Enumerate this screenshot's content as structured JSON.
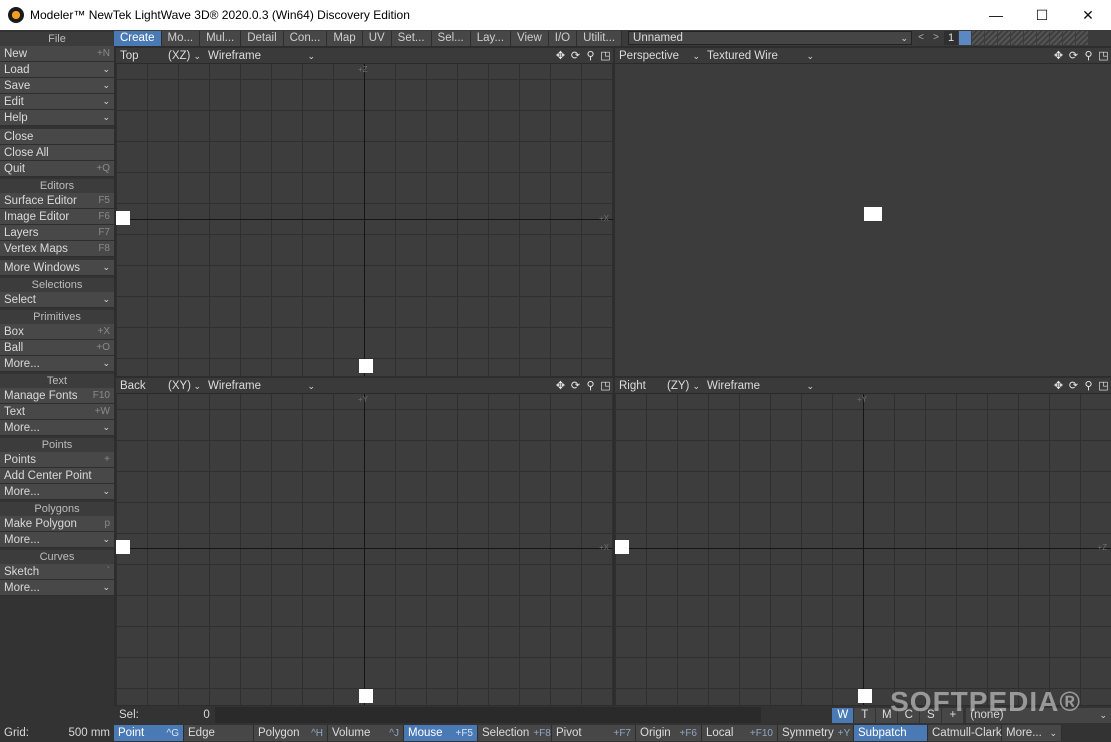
{
  "window": {
    "title": "Modeler™ NewTek LightWave 3D® 2020.0.3 (Win64) Discovery Edition",
    "minimize": "—",
    "maximize": "☐",
    "close": "✕"
  },
  "left": {
    "groups": [
      {
        "head": "File",
        "items": [
          {
            "label": "New",
            "sc": "+N"
          },
          {
            "label": "Load",
            "chev": "⌄"
          },
          {
            "label": "Save",
            "chev": "⌄"
          },
          {
            "label": "Edit",
            "chev": "⌄"
          },
          {
            "label": "Help",
            "chev": "⌄"
          }
        ]
      },
      {
        "head": "",
        "items": [
          {
            "label": "Close",
            "sc": ""
          },
          {
            "label": "Close All",
            "sc": ""
          },
          {
            "label": "Quit",
            "sc": "+Q"
          }
        ]
      },
      {
        "head": "Editors",
        "items": [
          {
            "label": "Surface Editor",
            "sc": "F5"
          },
          {
            "label": "Image Editor",
            "sc": "F6"
          },
          {
            "label": "Layers",
            "sc": "F7"
          },
          {
            "label": "Vertex Maps",
            "sc": "F8"
          }
        ]
      },
      {
        "head": "",
        "items": [
          {
            "label": "More Windows",
            "chev": "⌄"
          }
        ]
      },
      {
        "head": "Selections",
        "items": [
          {
            "label": "Select",
            "chev": "⌄"
          }
        ]
      },
      {
        "head": "Primitives",
        "items": [
          {
            "label": "Box",
            "sc": "+X"
          },
          {
            "label": "Ball",
            "sc": "+O"
          },
          {
            "label": "More...",
            "chev": "⌄"
          }
        ]
      },
      {
        "head": "Text",
        "items": [
          {
            "label": "Manage Fonts",
            "sc": "F10"
          },
          {
            "label": "Text",
            "sc": "+W"
          },
          {
            "label": "More...",
            "chev": "⌄"
          }
        ]
      },
      {
        "head": "Points",
        "items": [
          {
            "label": "Points",
            "sc": "+"
          },
          {
            "label": "Add Center Point",
            "sc": ""
          },
          {
            "label": "More...",
            "chev": "⌄"
          }
        ]
      },
      {
        "head": "Polygons",
        "items": [
          {
            "label": "Make Polygon",
            "sc": "p"
          },
          {
            "label": "More...",
            "chev": "⌄"
          }
        ]
      },
      {
        "head": "Curves",
        "items": [
          {
            "label": "Sketch",
            "sc": "`"
          },
          {
            "label": "More...",
            "chev": "⌄"
          }
        ]
      }
    ]
  },
  "tabs": [
    "Create",
    "Mo...",
    "Mul...",
    "Detail",
    "Con...",
    "Map",
    "UV",
    "Set...",
    "Sel...",
    "Lay...",
    "View",
    "I/O",
    "Utilit..."
  ],
  "object": {
    "name": "Unnamed",
    "chev": "⌄"
  },
  "layers": {
    "prev": "<",
    "next": ">",
    "current": "1"
  },
  "viewports": [
    {
      "name": "Top",
      "axes": "(XZ)",
      "mode": "Wireframe",
      "x_label": "+X",
      "y_label": "+Z"
    },
    {
      "name": "Perspective",
      "axes": "",
      "mode": "Textured Wire",
      "x_label": "",
      "y_label": ""
    },
    {
      "name": "Back",
      "axes": "(XY)",
      "mode": "Wireframe",
      "x_label": "+X",
      "y_label": "+Y"
    },
    {
      "name": "Right",
      "axes": "(ZY)",
      "mode": "Wireframe",
      "x_label": "+Z",
      "y_label": "+Y"
    }
  ],
  "vp_tools": {
    "move": "✥",
    "rotate": "⟳",
    "zoom": "⚲",
    "maximize": "◳"
  },
  "chev": "⌄",
  "sel": {
    "label": "Sel:",
    "value": "0"
  },
  "modes": [
    "W",
    "T",
    "M",
    "C",
    "S",
    "+"
  ],
  "vmap": {
    "value": "(none)"
  },
  "grid": {
    "label": "Grid:",
    "value": "500 mm"
  },
  "status_buttons": [
    {
      "label": "Point",
      "sc": "^G",
      "on": true
    },
    {
      "label": "Edge",
      "sc": "",
      "on": false
    },
    {
      "label": "Polygon",
      "sc": "^H",
      "on": false
    },
    {
      "label": "Volume",
      "sc": "^J",
      "on": false
    },
    {
      "label": "Mouse",
      "sc": "+F5",
      "on": true
    },
    {
      "label": "Selection",
      "sc": "+F8",
      "on": false
    },
    {
      "label": "Pivot",
      "sc": "+F7",
      "on": false
    },
    {
      "label": "Origin",
      "sc": "+F6",
      "on": false
    },
    {
      "label": "Local",
      "sc": "+F10",
      "on": false
    },
    {
      "label": "Symmetry",
      "sc": "+Y",
      "on": false
    },
    {
      "label": "Subpatch",
      "sc": "",
      "on": true
    },
    {
      "label": "Catmull-Clark",
      "sc": "",
      "on": false
    },
    {
      "label": "More...",
      "sc": "",
      "on": false
    }
  ],
  "watermark": "SOFTPEDIA®"
}
